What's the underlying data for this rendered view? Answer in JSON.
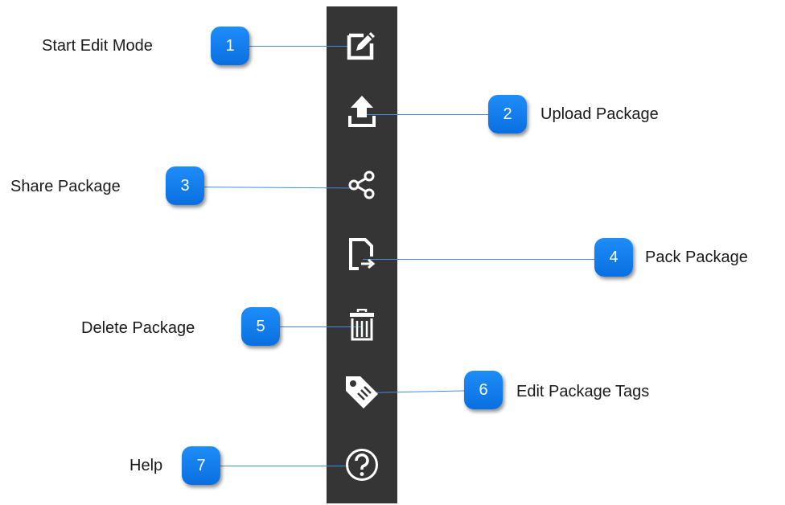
{
  "toolbar": {
    "buttons": [
      {
        "icon": "edit-icon"
      },
      {
        "icon": "upload-icon"
      },
      {
        "icon": "share-icon"
      },
      {
        "icon": "pack-icon"
      },
      {
        "icon": "trash-icon"
      },
      {
        "icon": "tag-icon"
      },
      {
        "icon": "help-icon"
      }
    ]
  },
  "callouts": [
    {
      "number": "1",
      "label": "Start Edit Mode"
    },
    {
      "number": "2",
      "label": "Upload Package"
    },
    {
      "number": "3",
      "label": "Share Package"
    },
    {
      "number": "4",
      "label": "Pack Package"
    },
    {
      "number": "5",
      "label": "Delete Package"
    },
    {
      "number": "6",
      "label": "Edit Package Tags"
    },
    {
      "number": "7",
      "label": "Help"
    }
  ],
  "colors": {
    "toolbar_background": "#353535",
    "icon": "#ffffff",
    "badge": "#1685f0",
    "callout_line": "#3e8de8"
  }
}
